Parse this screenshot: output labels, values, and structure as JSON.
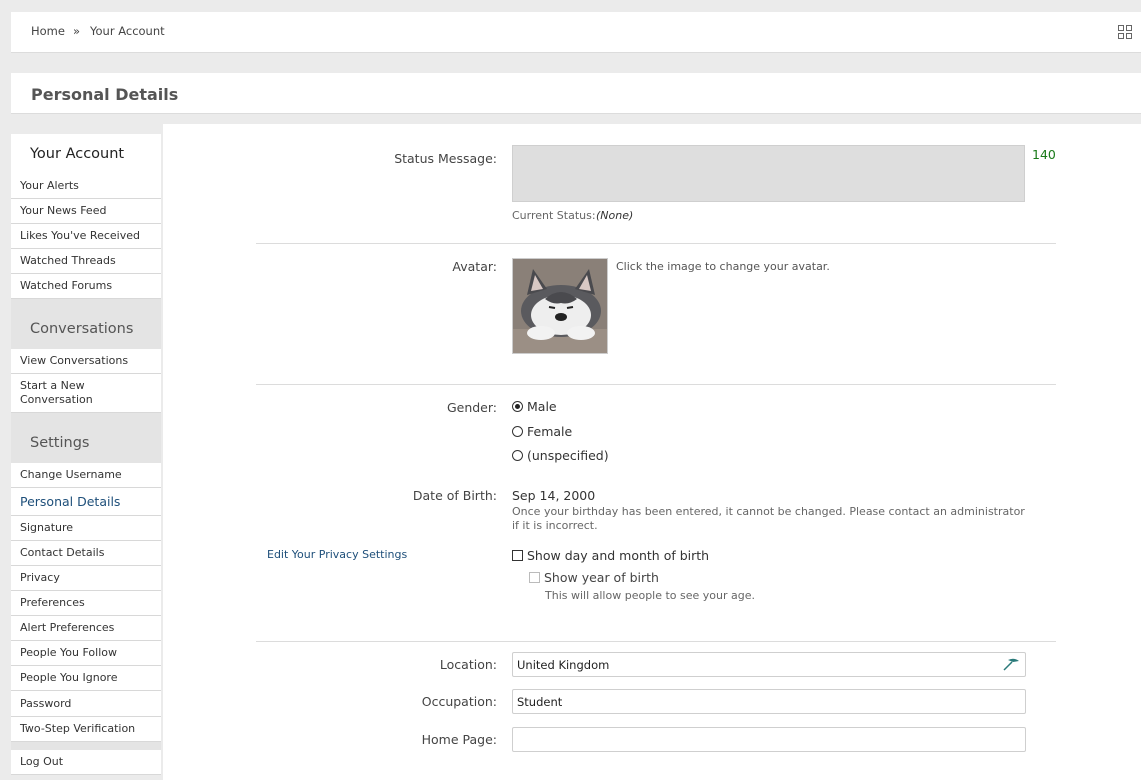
{
  "breadcrumb": {
    "home": "Home",
    "sep": "»",
    "current": "Your Account"
  },
  "page_title": "Personal Details",
  "sidebar": {
    "groups": [
      {
        "heading": "Your Account",
        "items": [
          "Your Alerts",
          "Your News Feed",
          "Likes You've Received",
          "Watched Threads",
          "Watched Forums"
        ]
      },
      {
        "heading": "Conversations",
        "items": [
          "View Conversations",
          "Start a New Conversation"
        ]
      },
      {
        "heading": "Settings",
        "items": [
          "Change Username",
          "Personal Details",
          "Signature",
          "Contact Details",
          "Privacy",
          "Preferences",
          "Alert Preferences",
          "People You Follow",
          "People You Ignore",
          "Password",
          "Two-Step Verification"
        ]
      }
    ],
    "active": "Personal Details",
    "logout": "Log Out"
  },
  "form": {
    "status": {
      "label": "Status Message:",
      "value": "",
      "counter": "140",
      "current_label": "Current Status:",
      "current_value": "(None)"
    },
    "avatar": {
      "label": "Avatar:",
      "hint": "Click the image to change your avatar."
    },
    "gender": {
      "label": "Gender:",
      "options": [
        "Male",
        "Female",
        "(unspecified)"
      ],
      "selected": "Male"
    },
    "dob": {
      "label": "Date of Birth:",
      "value": "Sep 14, 2000",
      "hint": "Once your birthday has been entered, it cannot be changed. Please contact an administrator if it is incorrect."
    },
    "privacy_link": "Edit Your Privacy Settings",
    "show_day_month": "Show day and month of birth",
    "show_year": "Show year of birth",
    "show_year_hint": "This will allow people to see your age.",
    "location": {
      "label": "Location:",
      "value": "United Kingdom"
    },
    "occupation": {
      "label": "Occupation:",
      "value": "Student"
    },
    "homepage": {
      "label": "Home Page:",
      "value": ""
    }
  },
  "colors": {
    "accent_link": "#1e4f7a",
    "counter_green": "#1a7a1a"
  }
}
